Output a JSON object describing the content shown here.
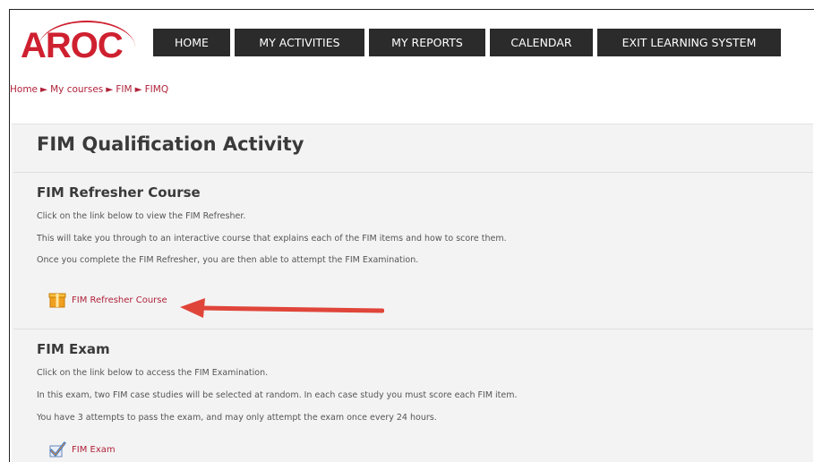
{
  "logo": {
    "text": "AROC"
  },
  "nav": {
    "items": [
      {
        "label": "HOME"
      },
      {
        "label": "MY ACTIVITIES"
      },
      {
        "label": "MY REPORTS"
      },
      {
        "label": "CALENDAR"
      },
      {
        "label": "EXIT LEARNING SYSTEM"
      }
    ]
  },
  "breadcrumb": [
    "Home",
    "My courses",
    "FIM",
    "FIMQ"
  ],
  "page": {
    "title": "FIM Qualification Activity"
  },
  "sections": [
    {
      "title": "FIM Refresher Course",
      "paragraphs": [
        "Click on the link below to view the FIM Refresher.",
        "This will take you through to an interactive course that explains each of the FIM items and how to score them.",
        "Once you complete the FIM Refresher, you are then able to attempt the FIM Examination."
      ],
      "link": {
        "label": "FIM Refresher Course",
        "icon": "package-icon"
      }
    },
    {
      "title": "FIM Exam",
      "paragraphs": [
        "Click on the link below to access the FIM Examination.",
        "In this exam, two FIM case studies will be selected at random. In each case study you must score each FIM item.",
        "You have 3 attempts to pass the exam, and may only attempt the exam once every 24 hours."
      ],
      "link": {
        "label": "FIM Exam",
        "icon": "quiz-check-icon"
      }
    }
  ],
  "colors": {
    "brand": "#cf2030",
    "link": "#b0233b",
    "nav_bg": "#2b2b2b",
    "arrow": "#e0453a"
  }
}
